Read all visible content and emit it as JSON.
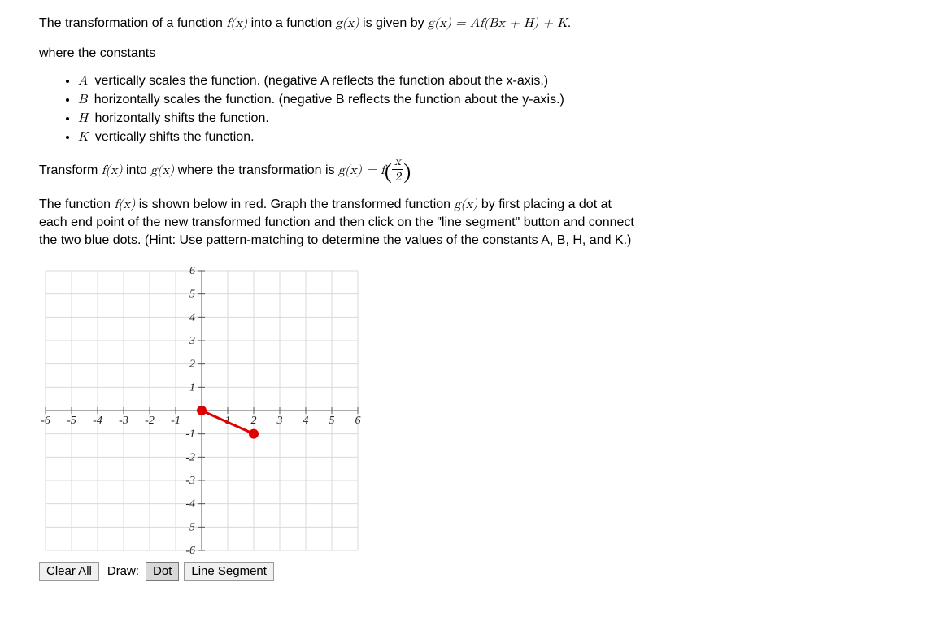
{
  "intro": {
    "prefix": "The transformation of a function ",
    "fx": "f(x)",
    "mid1": " into a function ",
    "gx": "g(x)",
    "mid2": " is given by ",
    "eq": "g(x) = Af(Bx + H) + K",
    "suffix": "."
  },
  "where": "where the constants",
  "bullets": [
    {
      "var": "A",
      "text": " vertically scales the function. (negative A reflects the function about the x-axis.)"
    },
    {
      "var": "B",
      "text": " horizontally scales the function. (negative B reflects the function about the y-axis.)"
    },
    {
      "var": "H",
      "text": " horizontally shifts the function."
    },
    {
      "var": "K",
      "text": " vertically shifts the function."
    }
  ],
  "transform": {
    "prefix": "Transform ",
    "fx": "f(x)",
    "mid1": " into ",
    "gx": "g(x)",
    "mid2": " where the transformation is ",
    "lhs": "g(x) = f",
    "num": "x",
    "den": "2"
  },
  "instructions": {
    "l1a": "The function ",
    "fx": "f(x)",
    "l1b": " is shown below in red. Graph the transformed function ",
    "gx": "g(x)",
    "l1c": " by first placing a dot at",
    "l2": "each end point of the new transformed function and then click on the \"line segment\" button and connect",
    "l3": "the two blue dots. (Hint: Use pattern-matching to determine the values of the constants A, B, H, and K.)"
  },
  "toolbar": {
    "clear": "Clear All",
    "draw": "Draw:",
    "dot": "Dot",
    "line": "Line Segment"
  },
  "chart_data": {
    "type": "line",
    "title": "",
    "xlabel": "",
    "ylabel": "",
    "xlim": [
      -6,
      6
    ],
    "ylim": [
      -6,
      6
    ],
    "x_ticks": [
      -6,
      -5,
      -4,
      -3,
      -2,
      -1,
      1,
      2,
      3,
      4,
      5,
      6
    ],
    "y_ticks": [
      -6,
      -5,
      -4,
      -3,
      -2,
      -1,
      1,
      2,
      3,
      4,
      5,
      6
    ],
    "grid": true,
    "series": [
      {
        "name": "f(x)",
        "color": "#d00",
        "points": [
          [
            0,
            0
          ],
          [
            2,
            -1
          ]
        ],
        "endpoints": true
      }
    ]
  }
}
